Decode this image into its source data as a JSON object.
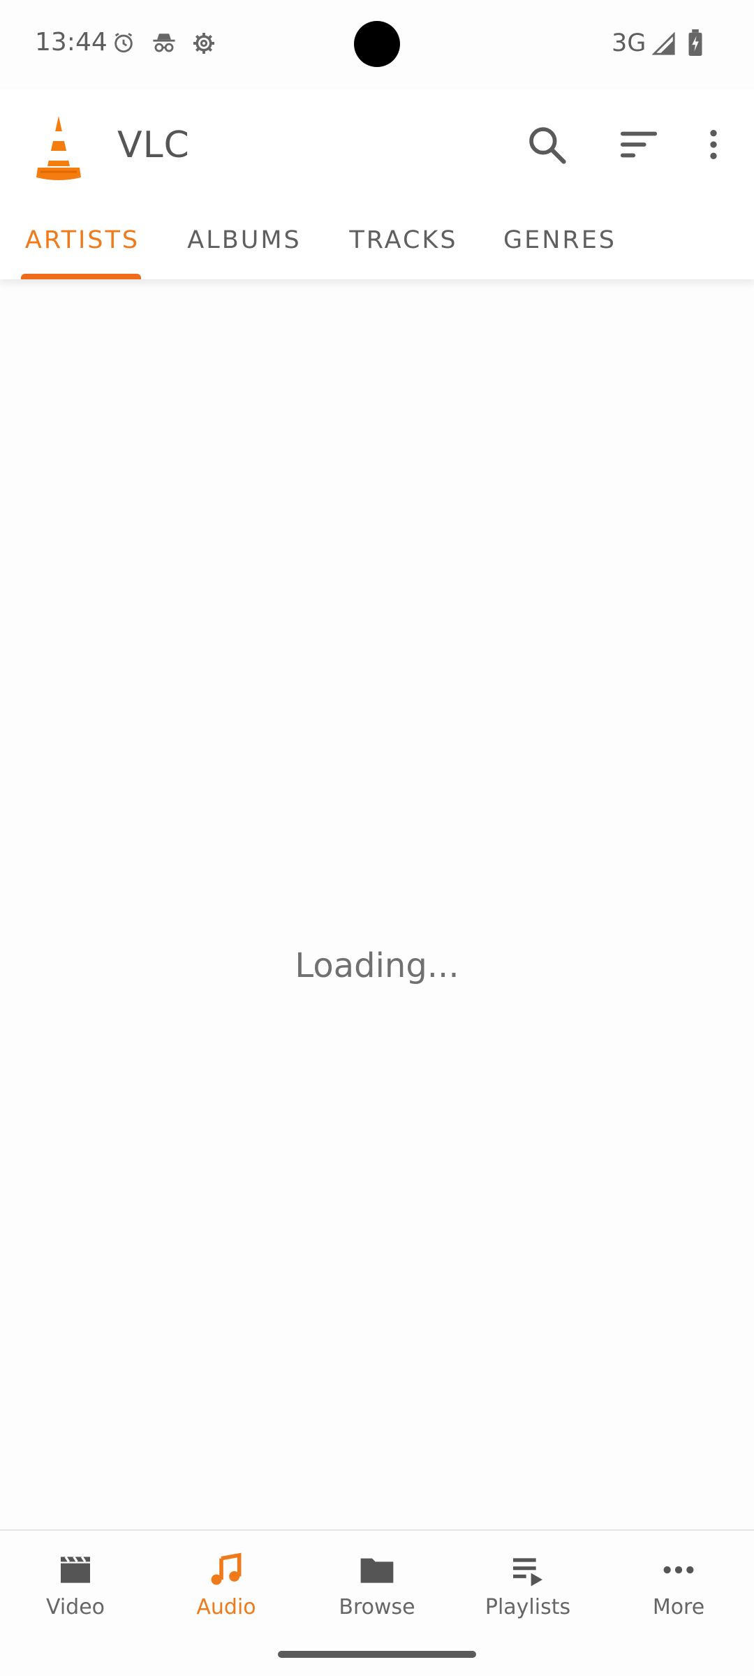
{
  "status_bar": {
    "time": "13:44",
    "network": "3G",
    "icons": [
      "alarm-icon",
      "incognito-icon",
      "settings-gear-icon",
      "signal-icon",
      "battery-charging-icon"
    ]
  },
  "app_bar": {
    "title": "VLC",
    "logo": "vlc-cone-logo",
    "actions": [
      "search-icon",
      "sort-icon",
      "more-vert-icon"
    ]
  },
  "tabs": [
    {
      "label": "ARTISTS",
      "active": true
    },
    {
      "label": "ALBUMS",
      "active": false
    },
    {
      "label": "TRACKS",
      "active": false
    },
    {
      "label": "GENRES",
      "active": false
    }
  ],
  "content": {
    "loading_text": "Loading..."
  },
  "bottom_nav": [
    {
      "label": "Video",
      "icon": "video-clapper-icon",
      "active": false
    },
    {
      "label": "Audio",
      "icon": "music-note-icon",
      "active": true
    },
    {
      "label": "Browse",
      "icon": "folder-icon",
      "active": false
    },
    {
      "label": "Playlists",
      "icon": "playlist-icon",
      "active": false
    },
    {
      "label": "More",
      "icon": "more-horiz-icon",
      "active": false
    }
  ],
  "colors": {
    "accent": "#f07a1a",
    "text": "#5f5f5f",
    "background": "#fdfdfd"
  }
}
